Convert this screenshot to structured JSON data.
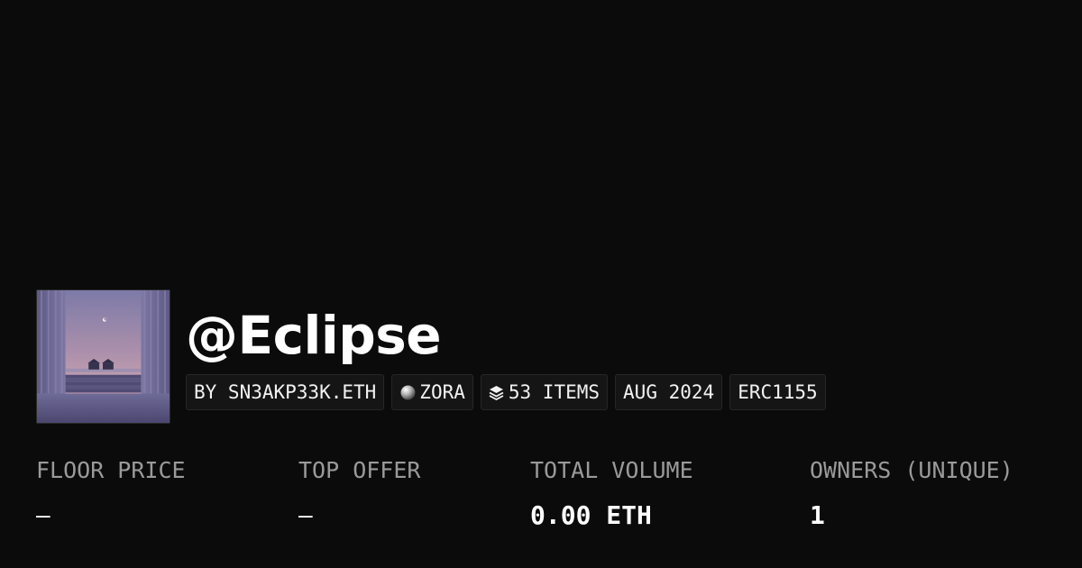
{
  "collection": {
    "title": "@Eclipse",
    "thumbnail_alt": "collection-artwork"
  },
  "chips": {
    "creator": "BY SN3AKP33K.ETH",
    "chain": "ZORA",
    "chain_icon": "zora-orb-icon",
    "items": "53 ITEMS",
    "items_icon": "layers-icon",
    "date": "AUG 2024",
    "standard": "ERC1155"
  },
  "stats": {
    "floor_price": {
      "label": "FLOOR PRICE",
      "value": "—"
    },
    "top_offer": {
      "label": "TOP OFFER",
      "value": "—"
    },
    "total_volume": {
      "label": "TOTAL VOLUME",
      "value": "0.00 ETH"
    },
    "owners": {
      "label": "OWNERS (UNIQUE)",
      "value": "1"
    }
  },
  "colors": {
    "background": "#0b0b0b",
    "text": "#ffffff",
    "muted": "#9a9a9a",
    "chip_bg": "#151515",
    "chip_border": "#262626"
  }
}
